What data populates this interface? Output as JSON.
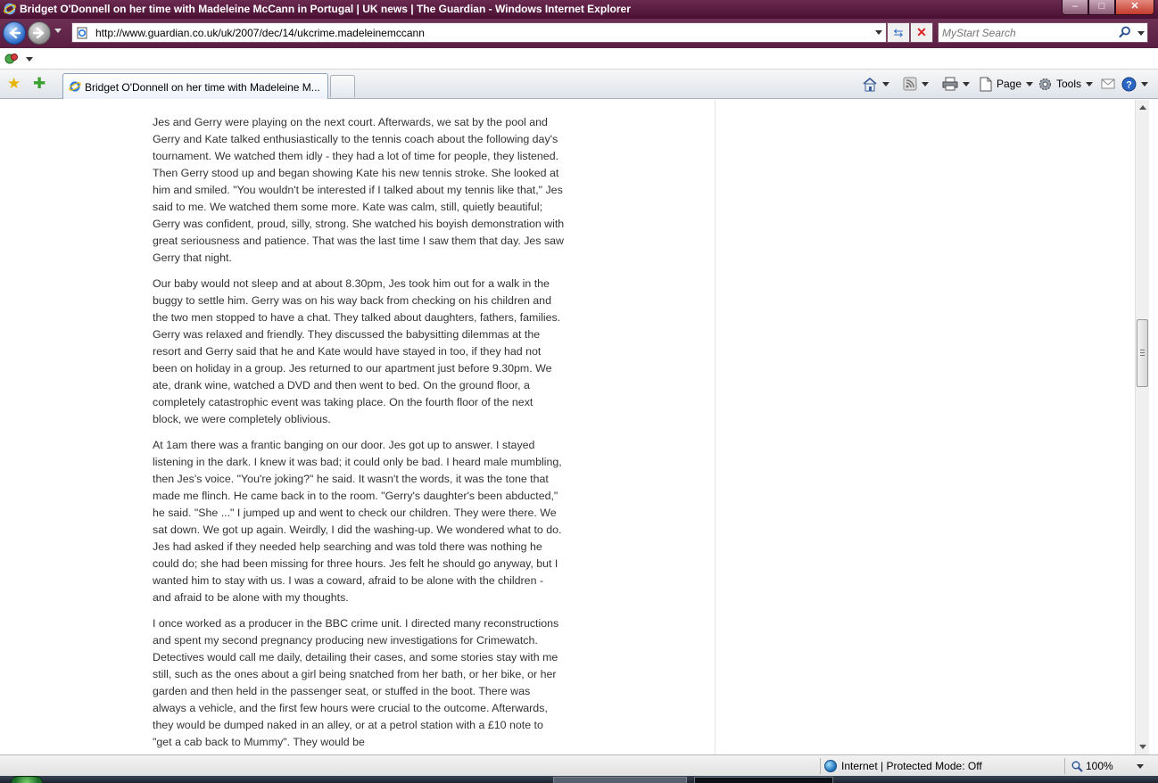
{
  "window": {
    "title": "Bridget O'Donnell on her time with Madeleine McCann in Portugal | UK news | The Guardian - Windows Internet Explorer",
    "min_label": "–",
    "max_label": "□",
    "close_label": "✕"
  },
  "address": {
    "url": "http://www.guardian.co.uk/uk/2007/dec/14/ukcrime.madeleinemccann"
  },
  "search": {
    "placeholder": "MyStart Search"
  },
  "tab": {
    "label": "Bridget O'Donnell on her time with Madeleine M..."
  },
  "commands": {
    "page": "Page",
    "tools": "Tools"
  },
  "article": {
    "paragraphs": [
      "Jes and Gerry were playing on the next court. Afterwards, we sat by the pool and Gerry and Kate talked enthusiastically to the tennis coach about the following day's tournament. We watched them idly - they had a lot of time for people, they listened. Then Gerry stood up and began showing Kate his new tennis stroke. She looked at him and smiled. \"You wouldn't be interested if I talked about my tennis like that,\" Jes said to me. We watched them some more. Kate was calm, still, quietly beautiful; Gerry was confident, proud, silly, strong. She watched his boyish demonstration with great seriousness and patience. That was the last time I saw them that day. Jes saw Gerry that night.",
      "Our baby would not sleep and at about 8.30pm, Jes took him out for a walk in the buggy to settle him. Gerry was on his way back from checking on his children and the two men stopped to have a chat. They talked about daughters, fathers, families. Gerry was relaxed and friendly. They discussed the babysitting dilemmas at the resort and Gerry said that he and Kate would have stayed in too, if they had not been on holiday in a group. Jes returned to our apartment just before 9.30pm. We ate, drank wine, watched a DVD and then went to bed. On the ground floor, a completely catastrophic event was taking place. On the fourth floor of the next block, we were completely oblivious.",
      "At 1am there was a frantic banging on our door. Jes got up to answer. I stayed listening in the dark. I knew it was bad; it could only be bad. I heard male mumbling, then Jes's voice. \"You're joking?\" he said. It wasn't the words, it was the tone that made me flinch. He came back in to the room. \"Gerry's daughter's been abducted,\" he said. \"She ...\" I jumped up and went to check our children. They were there. We sat down. We got up again. Weirdly, I did the washing-up. We wondered what to do. Jes had asked if they needed help searching and was told there was nothing he could do; she had been missing for three hours. Jes felt he should go anyway, but I wanted him to stay with us. I was a coward, afraid to be alone with the children - and afraid to be alone with my thoughts.",
      "I once worked as a producer in the BBC crime unit. I directed many reconstructions and spent my second pregnancy producing new investigations for Crimewatch. Detectives would call me daily, detailing their cases, and some stories stay with me still, such as the ones about a girl being snatched from her bath, or her bike, or her garden and then held in the passenger seat, or stuffed in the boot. There was always a vehicle, and the first few hours were crucial to the outcome. Afterwards, they would be dumped naked in an alley, or at a petrol station with a £10 note to \"get a cab back to Mummy\". They would be"
    ]
  },
  "status": {
    "zone": "Internet | Protected Mode: Off",
    "zoom": "100%"
  },
  "colors": {
    "titlebar": "#5a1e43",
    "text": "#333333"
  }
}
